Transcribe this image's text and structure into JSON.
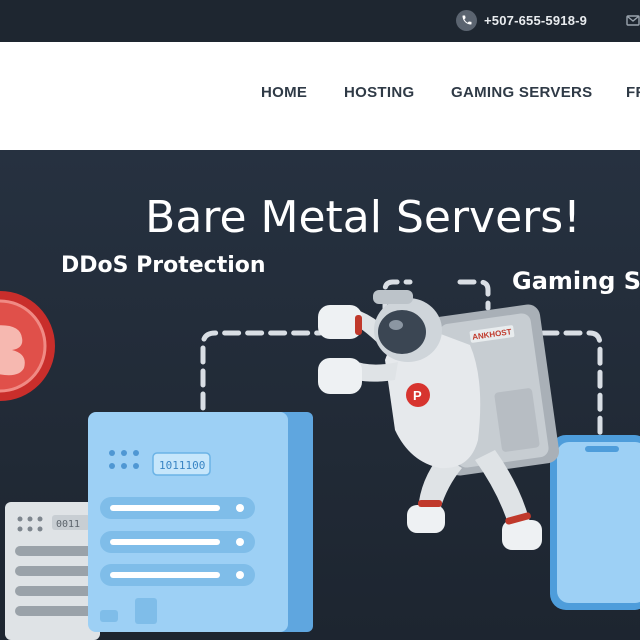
{
  "topbar": {
    "phone": "+507-655-5918-9",
    "phone_icon": "phone-icon",
    "mail_icon": "mail-icon"
  },
  "nav": {
    "items": [
      {
        "label": "HOME"
      },
      {
        "label": "HOSTING"
      },
      {
        "label": "GAMING SERVERS"
      },
      {
        "label": "FR"
      }
    ]
  },
  "hero": {
    "title": "Bare Metal Servers!",
    "feature_left": "DDoS Protection",
    "feature_right": "Gaming S",
    "server_label": "1011100",
    "server_label_small": "0011",
    "backpack_brand": "ANKHOST",
    "badge_letter": "P"
  },
  "colors": {
    "topbar_bg": "#1e2630",
    "hero_bg": "#232c38",
    "server_blue": "#8ec7f2",
    "badge_red": "#d7342f"
  }
}
